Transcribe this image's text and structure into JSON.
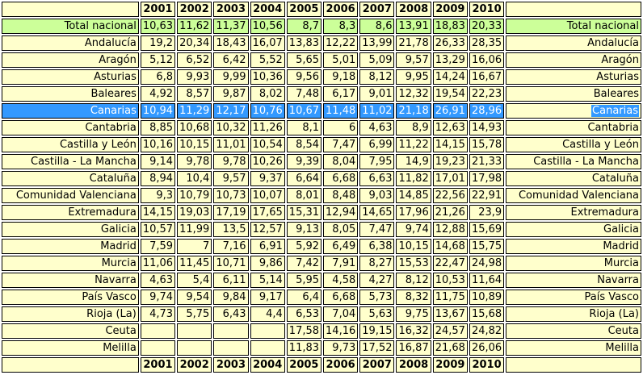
{
  "years": [
    "2001",
    "2002",
    "2003",
    "2004",
    "2005",
    "2006",
    "2007",
    "2008",
    "2009",
    "2010"
  ],
  "rows": [
    {
      "name": "Total nacional",
      "values": [
        "10,63",
        "11,62",
        "11,37",
        "10,56",
        "8,7",
        "8,3",
        "8,6",
        "13,91",
        "18,83",
        "20,33"
      ],
      "style": "total"
    },
    {
      "name": "Andalucía",
      "values": [
        "19,2",
        "20,34",
        "18,43",
        "16,07",
        "13,83",
        "12,22",
        "13,99",
        "21,78",
        "26,33",
        "28,35"
      ]
    },
    {
      "name": "Aragón",
      "values": [
        "5,12",
        "6,52",
        "6,42",
        "5,52",
        "5,65",
        "5,01",
        "5,09",
        "9,57",
        "13,29",
        "16,06"
      ]
    },
    {
      "name": "Asturias",
      "values": [
        "6,8",
        "9,93",
        "9,99",
        "10,36",
        "9,56",
        "9,18",
        "8,12",
        "9,95",
        "14,24",
        "16,67"
      ]
    },
    {
      "name": "Baleares",
      "values": [
        "4,92",
        "8,57",
        "9,87",
        "8,02",
        "7,48",
        "6,17",
        "9,01",
        "12,32",
        "19,54",
        "22,23"
      ]
    },
    {
      "name": "Canarias",
      "values": [
        "10,94",
        "11,29",
        "12,17",
        "10,76",
        "10,67",
        "11,48",
        "11,02",
        "21,18",
        "26,91",
        "28,96"
      ],
      "style": "sel"
    },
    {
      "name": "Cantabria",
      "values": [
        "8,85",
        "10,68",
        "10,32",
        "11,26",
        "8,1",
        "6",
        "4,63",
        "8,9",
        "12,63",
        "14,93"
      ]
    },
    {
      "name": "Castilla y León",
      "values": [
        "10,16",
        "10,15",
        "11,01",
        "10,54",
        "8,54",
        "7,47",
        "6,99",
        "11,22",
        "14,15",
        "15,78"
      ]
    },
    {
      "name": "Castilla - La Mancha",
      "values": [
        "9,14",
        "9,78",
        "9,78",
        "10,26",
        "9,39",
        "8,04",
        "7,95",
        "14,9",
        "19,23",
        "21,33"
      ]
    },
    {
      "name": "Cataluña",
      "values": [
        "8,94",
        "10,4",
        "9,57",
        "9,37",
        "6,64",
        "6,68",
        "6,63",
        "11,82",
        "17,01",
        "17,98"
      ]
    },
    {
      "name": "Comunidad Valenciana",
      "values": [
        "9,3",
        "10,79",
        "10,73",
        "10,07",
        "8,01",
        "8,48",
        "9,03",
        "14,85",
        "22,56",
        "22,91"
      ]
    },
    {
      "name": "Extremadura",
      "values": [
        "14,15",
        "19,03",
        "17,19",
        "17,65",
        "15,31",
        "12,94",
        "14,65",
        "17,96",
        "21,26",
        "23,9"
      ]
    },
    {
      "name": "Galicia",
      "values": [
        "10,57",
        "11,99",
        "13,5",
        "12,57",
        "9,13",
        "8,05",
        "7,47",
        "9,74",
        "12,88",
        "15,69"
      ]
    },
    {
      "name": "Madrid",
      "values": [
        "7,59",
        "7",
        "7,16",
        "6,91",
        "5,92",
        "6,49",
        "6,38",
        "10,15",
        "14,68",
        "15,75"
      ]
    },
    {
      "name": "Murcia",
      "values": [
        "11,06",
        "11,45",
        "10,71",
        "9,86",
        "7,42",
        "7,91",
        "8,27",
        "15,53",
        "22,47",
        "24,98"
      ]
    },
    {
      "name": "Navarra",
      "values": [
        "4,63",
        "5,4",
        "6,11",
        "5,14",
        "5,95",
        "4,58",
        "4,27",
        "8,12",
        "10,53",
        "11,64"
      ]
    },
    {
      "name": "País Vasco",
      "values": [
        "9,74",
        "9,54",
        "9,84",
        "9,17",
        "6,4",
        "6,68",
        "5,73",
        "8,32",
        "11,75",
        "10,89"
      ]
    },
    {
      "name": "Rioja (La)",
      "values": [
        "4,73",
        "5,75",
        "6,43",
        "4,4",
        "6,53",
        "7,04",
        "5,63",
        "9,75",
        "13,67",
        "15,68"
      ]
    },
    {
      "name": "Ceuta",
      "values": [
        "",
        "",
        "",
        "",
        "17,58",
        "14,16",
        "19,15",
        "16,32",
        "24,57",
        "24,82"
      ]
    },
    {
      "name": "Melilla",
      "values": [
        "",
        "",
        "",
        "",
        "11,83",
        "9,73",
        "17,52",
        "16,87",
        "21,68",
        "26,06"
      ]
    }
  ],
  "colors": {
    "cell_bg": "#ffffcc",
    "total_bg": "#ccff99",
    "selected_bg": "#3399ff"
  }
}
